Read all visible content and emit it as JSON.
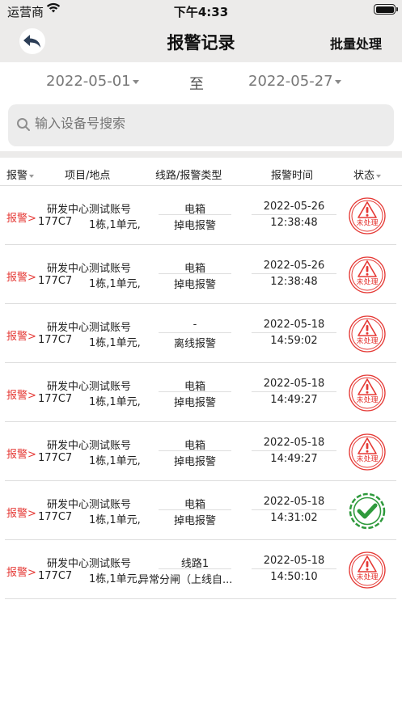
{
  "status_bar": {
    "carrier": "运营商",
    "time": "下午4:33"
  },
  "nav": {
    "title": "报警记录",
    "action": "批量处理"
  },
  "date_range": {
    "from": "2022-05-01",
    "to_label": "至",
    "to": "2022-05-27"
  },
  "search": {
    "placeholder": "输入设备号搜索"
  },
  "table_headers": {
    "alarm": "报警",
    "project": "项目/地点",
    "line": "线路/报警类型",
    "time": "报警时间",
    "state": "状态"
  },
  "rows": [
    {
      "alarm": "报警>",
      "project": "研发中心测试账号",
      "device": "177C7",
      "location": "1栋,1单元,",
      "line": "电箱",
      "type": "掉电报警",
      "date": "2022-05-26",
      "time": "12:38:48",
      "state": "未处理"
    },
    {
      "alarm": "报警>",
      "project": "研发中心测试账号",
      "device": "177C7",
      "location": "1栋,1单元,",
      "line": "电箱",
      "type": "掉电报警",
      "date": "2022-05-26",
      "time": "12:38:48",
      "state": "未处理"
    },
    {
      "alarm": "报警>",
      "project": "研发中心测试账号",
      "device": "177C7",
      "location": "1栋,1单元,",
      "line": "-",
      "type": "离线报警",
      "date": "2022-05-18",
      "time": "14:59:02",
      "state": "未处理"
    },
    {
      "alarm": "报警>",
      "project": "研发中心测试账号",
      "device": "177C7",
      "location": "1栋,1单元,",
      "line": "电箱",
      "type": "掉电报警",
      "date": "2022-05-18",
      "time": "14:49:27",
      "state": "未处理"
    },
    {
      "alarm": "报警>",
      "project": "研发中心测试账号",
      "device": "177C7",
      "location": "1栋,1单元,",
      "line": "电箱",
      "type": "掉电报警",
      "date": "2022-05-18",
      "time": "14:49:27",
      "state": "未处理"
    },
    {
      "alarm": "报警>",
      "project": "研发中心测试账号",
      "device": "177C7",
      "location": "1栋,1单元,",
      "line": "电箱",
      "type": "掉电报警",
      "date": "2022-05-18",
      "time": "14:31:02",
      "state": "processed"
    },
    {
      "alarm": "报警>",
      "project": "研发中心测试账号",
      "device": "177C7",
      "location": "1栋,1单元,",
      "line": "线路1",
      "type": "异常分闸（上线自...",
      "date": "2022-05-18",
      "time": "14:50:10",
      "state": "未处理"
    }
  ],
  "colors": {
    "nav_bg": "#ecebea",
    "alarm_red": "#e53935",
    "stamp_red": "#e53935",
    "done_green": "#2e9a3c"
  }
}
